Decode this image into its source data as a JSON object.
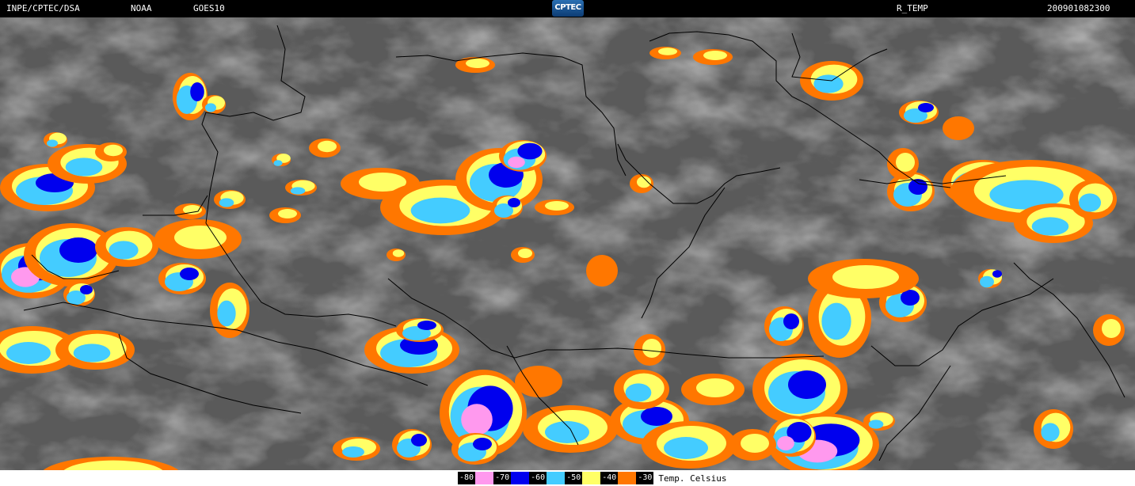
{
  "header": {
    "source": "INPE/CPTEC/DSA",
    "agency": "NOAA",
    "satellite": "GOES10",
    "logo_text": "CPTEC",
    "product": "R_TEMP",
    "datetime": "200901082300"
  },
  "legend": {
    "items": [
      {
        "label": "-80",
        "color": "#ff99ee"
      },
      {
        "label": "-70",
        "color": "#0000ee"
      },
      {
        "label": "-60",
        "color": "#44ccff"
      },
      {
        "label": "-50",
        "color": "#ffff66"
      },
      {
        "label": "-40",
        "color": "#ff7700"
      },
      {
        "label": "-30",
        "color": ""
      }
    ],
    "unit": "Temp. Celsius"
  }
}
